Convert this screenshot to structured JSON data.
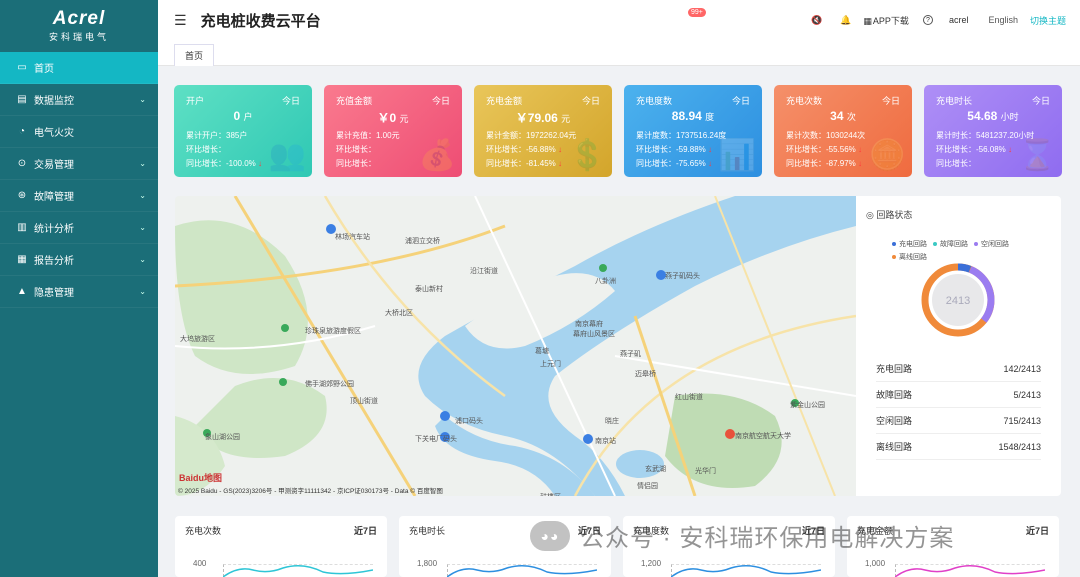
{
  "sidebar": {
    "brand": "Acrel",
    "brand_sub": "安科瑞电气",
    "items": [
      {
        "label": "首页",
        "icon": "monitor-icon",
        "active": true,
        "has_arrow": false
      },
      {
        "label": "数据监控",
        "icon": "chart-box-icon",
        "has_arrow": true
      },
      {
        "label": "电气火灾",
        "icon": "fire-icon",
        "has_arrow": false
      },
      {
        "label": "交易管理",
        "icon": "trade-icon",
        "has_arrow": true
      },
      {
        "label": "故障管理",
        "icon": "fault-icon",
        "has_arrow": true
      },
      {
        "label": "统计分析",
        "icon": "bar-chart-icon",
        "has_arrow": true
      },
      {
        "label": "报告分析",
        "icon": "report-icon",
        "has_arrow": true
      },
      {
        "label": "隐患管理",
        "icon": "warning-icon",
        "has_arrow": true
      }
    ]
  },
  "header": {
    "title": "充电桩收费云平台",
    "badge": "99+",
    "app_download": "APP下载",
    "user": "acrel",
    "language": "English",
    "theme": "切换主题"
  },
  "tabs": [
    {
      "label": "首页"
    }
  ],
  "cards": [
    {
      "label": "开户",
      "today": "今日",
      "value": "0",
      "unit": "户",
      "line1": "累计开户：385户",
      "line2": "环比增长：",
      "line3": "同比增长：-100.0%",
      "color": "#2fc8b4",
      "color2": "#5ee0c4"
    },
    {
      "label": "充值金额",
      "today": "今日",
      "value": "￥0",
      "unit": "元",
      "line1": "累计充值：1.00元",
      "line2": "环比增长：",
      "line3": "同比增长：",
      "color": "#ee4d74",
      "color2": "#fa7a8e"
    },
    {
      "label": "充电金额",
      "today": "今日",
      "value": "￥79.06",
      "unit": "元",
      "line1": "累计金额：1972262.04元",
      "line2": "环比增长：-56.88%",
      "line3": "同比增长：-81.45%",
      "color": "#d3a52b",
      "color2": "#e9c65a"
    },
    {
      "label": "充电度数",
      "today": "今日",
      "value": "88.94",
      "unit": "度",
      "line1": "累计度数：1737516.24度",
      "line2": "环比增长：-59.88%",
      "line3": "同比增长：-75.65%",
      "color": "#2d8fe0",
      "color2": "#4cb2ee"
    },
    {
      "label": "充电次数",
      "today": "今日",
      "value": "34",
      "unit": "次",
      "line1": "累计次数：1030244次",
      "line2": "环比增长：-55.56%",
      "line3": "同比增长：-87.97%",
      "color": "#ef6b3f",
      "color2": "#f5906a"
    },
    {
      "label": "充电时长",
      "today": "今日",
      "value": "54.68",
      "unit": "小时",
      "line1": "累计时长：5481237.20小时",
      "line2": "环比增长：-56.08%",
      "line3": "同比增长：",
      "color": "#8f6cf0",
      "color2": "#ae8ff6"
    }
  ],
  "map": {
    "labels": [
      "林场汽车站",
      "浦泗立交桥",
      "沿江街道",
      "泰山新村",
      "大桥北区",
      "八卦洲",
      "燕子矶码头",
      "南京幕府",
      "幕府山风景区",
      "珍珠泉旅游度假区",
      "顶山街道",
      "浦口码头",
      "下关电厂码头",
      "上元门",
      "燕子矶",
      "红山街道",
      "南京站",
      "南京航空航天大学",
      "玄武湖",
      "情侣园",
      "紫金山公园",
      "大坞旅游区",
      "佛手湖郊野公园",
      "象山湖公园",
      "鼓楼区",
      "葛塘",
      "迈皋桥",
      "光华门",
      "晓庄"
    ],
    "copyright": "© 2025 Baidu - GS(2023)3206号 - 甲测资字11111342 - 京ICP证030173号 - Data © 百度智图",
    "baidu": "Baidu地图"
  },
  "status_panel": {
    "title": "回路状态",
    "legend": [
      {
        "name": "充电回路",
        "color": "#3b6fd8"
      },
      {
        "name": "故障回路",
        "color": "#3cc9c4"
      },
      {
        "name": "空闲回路",
        "color": "#9b7cf0"
      },
      {
        "name": "离线回路",
        "color": "#f08a3a"
      }
    ],
    "total": "2413",
    "rows": [
      {
        "label": "充电回路",
        "value": "142/2413"
      },
      {
        "label": "故障回路",
        "value": "5/2413"
      },
      {
        "label": "空闲回路",
        "value": "715/2413"
      },
      {
        "label": "离线回路",
        "value": "1548/2413"
      }
    ]
  },
  "bottom_cards": [
    {
      "title": "充电次数",
      "range": "近7日",
      "ytick": "400"
    },
    {
      "title": "充电时长",
      "range": "近7日",
      "ytick": "1,800"
    },
    {
      "title": "充电度数",
      "range": "近7日",
      "ytick": "1,200"
    },
    {
      "title": "充电金额",
      "range": "近7日",
      "ytick": "1,000"
    }
  ],
  "watermark": "公众号 · 安科瑞环保用电解决方案"
}
